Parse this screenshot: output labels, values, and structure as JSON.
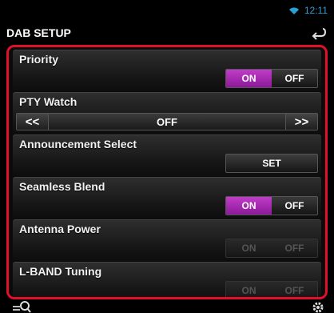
{
  "status": {
    "time": "12:11",
    "wifi_icon": "wifi-icon"
  },
  "header": {
    "title": "DAB SETUP",
    "back_icon": "back-arrow-icon"
  },
  "settings": {
    "priority": {
      "label": "Priority",
      "on": "ON",
      "off": "OFF",
      "selected": "ON",
      "enabled": true
    },
    "pty_watch": {
      "label": "PTY Watch",
      "prev": "<<",
      "value": "OFF",
      "next": ">>"
    },
    "announcement": {
      "label": "Announcement Select",
      "button": "SET"
    },
    "seamless_blend": {
      "label": "Seamless Blend",
      "on": "ON",
      "off": "OFF",
      "selected": "ON",
      "enabled": true
    },
    "antenna_power": {
      "label": "Antenna Power",
      "on": "ON",
      "off": "OFF",
      "enabled": false
    },
    "lband_tuning": {
      "label": "L-BAND Tuning",
      "on": "ON",
      "off": "OFF",
      "enabled": false
    }
  },
  "footer": {
    "left_icon": "search-list-icon",
    "right_icon": "settings-gear-icon"
  },
  "colors": {
    "accent": "#c13cc8",
    "frame": "#e0102a",
    "status": "#2a9fd6"
  }
}
